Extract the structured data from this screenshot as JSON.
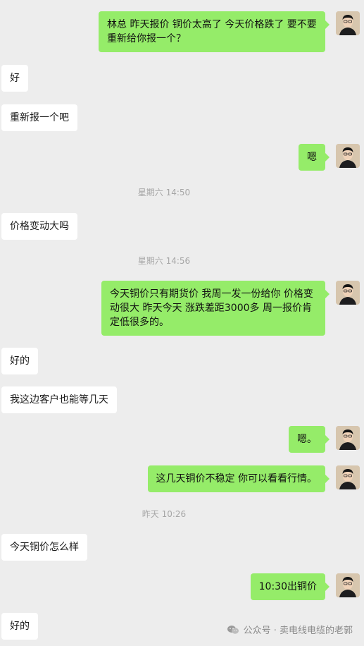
{
  "messages": [
    {
      "side": "out",
      "text": "林总 昨天报价 铜价太高了 今天价格跌了 要不要重新给你报一个？"
    },
    {
      "side": "in",
      "text": "好"
    },
    {
      "side": "in",
      "text": "重新报一个吧"
    },
    {
      "side": "out",
      "text": "嗯"
    },
    {
      "side": "in",
      "text": "价格变动大吗"
    },
    {
      "side": "out",
      "text": "今天铜价只有期货价 我周一发一份给你  价格变动很大  昨天今天 涨跌差距3000多 周一报价肯定低很多的。"
    },
    {
      "side": "in",
      "text": "好的"
    },
    {
      "side": "in",
      "text": "我这边客户也能等几天"
    },
    {
      "side": "out",
      "text": "嗯。"
    },
    {
      "side": "out",
      "text": "这几天铜价不稳定 你可以看看行情。"
    },
    {
      "side": "in",
      "text": "今天铜价怎么样"
    },
    {
      "side": "out",
      "text": "10:30出铜价"
    },
    {
      "side": "in",
      "text": "好的"
    }
  ],
  "timestamps": [
    "星期六 14:50",
    "星期六 14:56",
    "昨天 10:26"
  ],
  "watermark": {
    "icon": "wechat-official-account-icon",
    "text": "公众号 · 卖电线电缆的老郭"
  },
  "colors": {
    "background": "#ededed",
    "outgoing_bubble": "#95ec69",
    "incoming_bubble": "#ffffff"
  }
}
